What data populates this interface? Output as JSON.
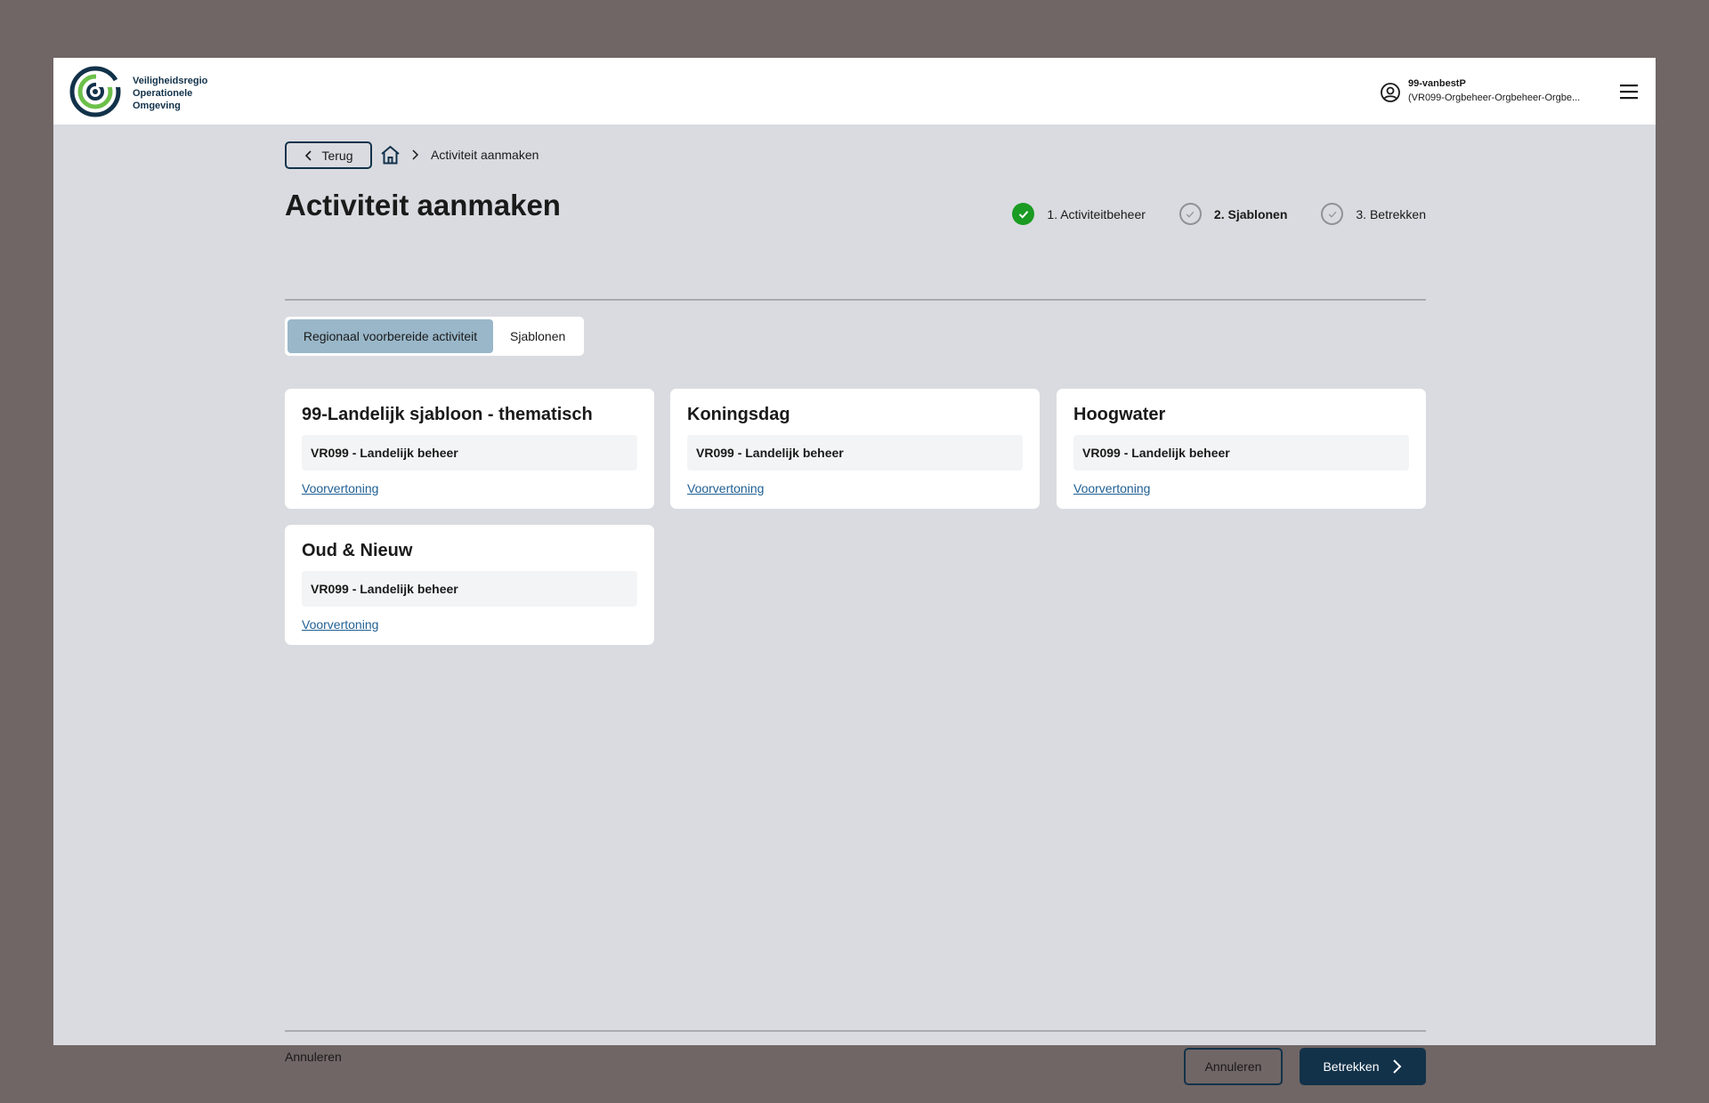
{
  "header": {
    "logo_lines": [
      "Veiligheidsregio",
      "Operationele",
      "Omgeving"
    ],
    "user_name": "99-vanbestP",
    "user_org": "(VR099-Orgbeheer-Orgbeheer-Orgbe...",
    "icons": {
      "user": "user-circle-icon",
      "menu": "hamburger-menu-icon"
    }
  },
  "breadcrumb": {
    "back_label": "Terug",
    "current": "Activiteit aanmaken"
  },
  "page": {
    "title": "Activiteit aanmaken"
  },
  "steps": [
    {
      "label": "1. Activiteitbeheer",
      "state": "done"
    },
    {
      "label": "2. Sjablonen",
      "state": "active"
    },
    {
      "label": "3. Betrekken",
      "state": "todo"
    }
  ],
  "tabs": [
    {
      "label": "Regionaal voorbereide activiteit",
      "selected": true
    },
    {
      "label": "Sjablonen",
      "selected": false
    }
  ],
  "cards": [
    {
      "title": "99-Landelijk sjabloon - thematisch",
      "tag": "VR099 - Landelijk beheer",
      "link": "Voorvertoning"
    },
    {
      "title": "Koningsdag",
      "tag": "VR099 - Landelijk beheer",
      "link": "Voorvertoning"
    },
    {
      "title": "Hoogwater",
      "tag": "VR099 - Landelijk beheer",
      "link": "Voorvertoning"
    },
    {
      "title": "Oud & Nieuw",
      "tag": "VR099 - Landelijk beheer",
      "link": "Voorvertoning"
    }
  ],
  "footer": {
    "left_text": "Annuleren",
    "cancel_label": "Annuleren",
    "next_label": "Betrekken"
  },
  "colors": {
    "primary": "#12324a",
    "success": "#1a9b22",
    "tab_selected": "#99b7c9",
    "link": "#1f5f93",
    "background": "#dadbe0",
    "logo_green": "#6cc04a"
  }
}
